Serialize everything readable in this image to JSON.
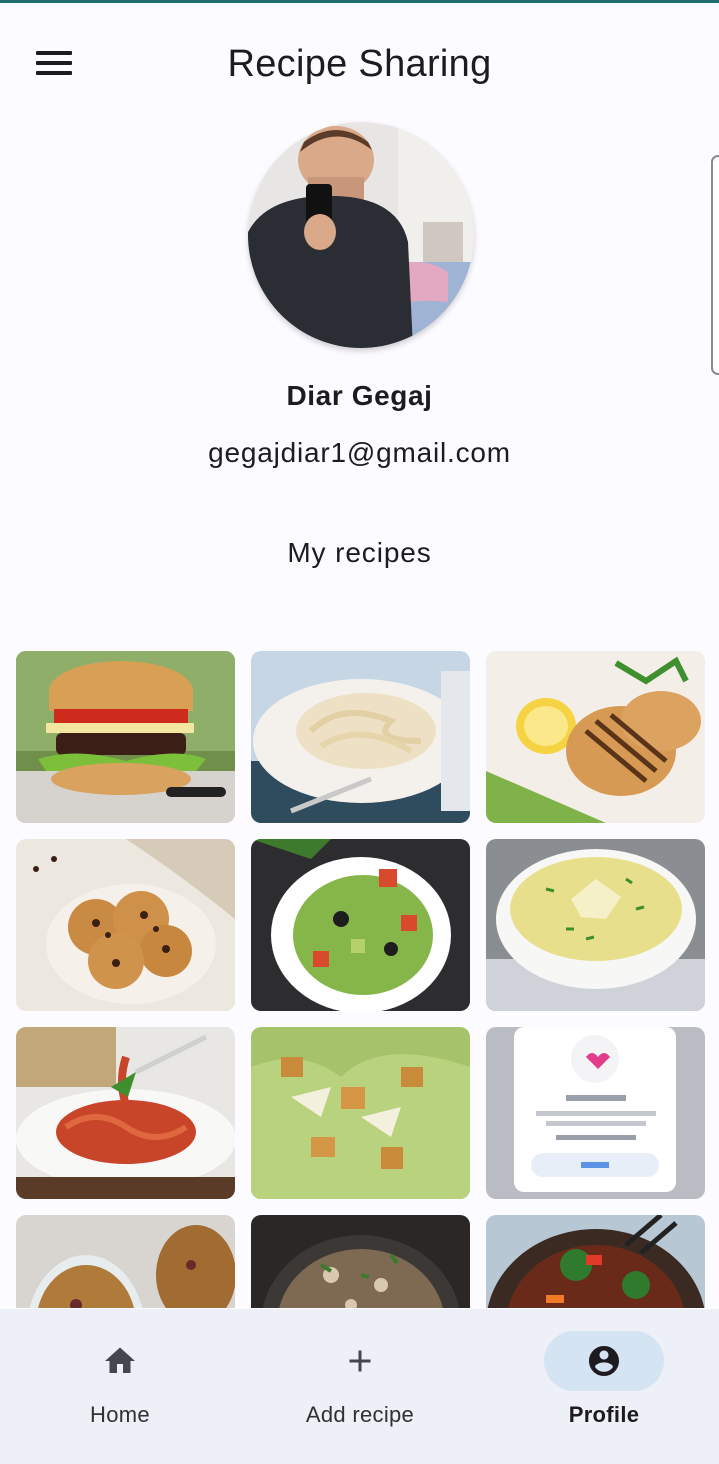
{
  "app": {
    "title": "Recipe Sharing"
  },
  "profile": {
    "name": "Diar Gegaj",
    "email": "gegajdiar1@gmail.com"
  },
  "recipes_section": {
    "title": "My recipes"
  },
  "recipes": [
    {
      "image": "burger"
    },
    {
      "image": "creamy-pasta"
    },
    {
      "image": "grilled-chicken"
    },
    {
      "image": "chocolate-chip-cookies"
    },
    {
      "image": "green-salad"
    },
    {
      "image": "creamy-soup"
    },
    {
      "image": "spaghetti"
    },
    {
      "image": "caesar-salad"
    },
    {
      "image": "app-screenshot"
    },
    {
      "image": "granola"
    },
    {
      "image": "risotto"
    },
    {
      "image": "stir-fry"
    }
  ],
  "bottom_nav": [
    {
      "label": "Home",
      "icon": "home-icon",
      "active": false
    },
    {
      "label": "Add recipe",
      "icon": "plus-icon",
      "active": false
    },
    {
      "label": "Profile",
      "icon": "account-circle-icon",
      "active": true
    }
  ],
  "colors": {
    "background": "#fcfbff",
    "nav_background": "#edf0f6",
    "active_pill": "#d5e4f2",
    "text": "#1d1b20"
  }
}
